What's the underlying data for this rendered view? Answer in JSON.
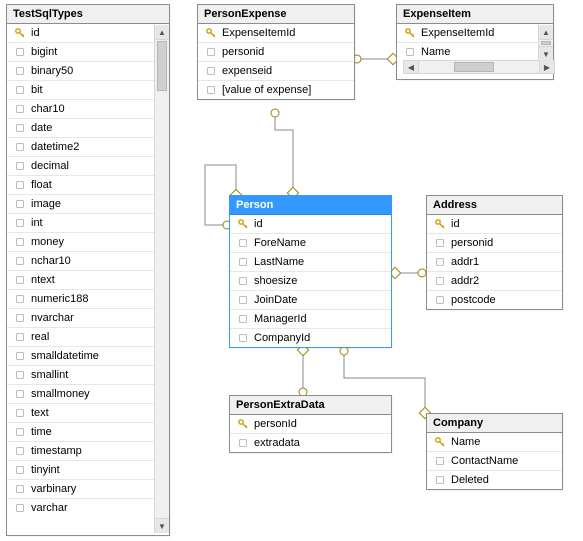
{
  "tables": {
    "testSqlTypes": {
      "title": "TestSqlTypes",
      "columns": [
        {
          "name": "id",
          "key": true
        },
        {
          "name": "bigint"
        },
        {
          "name": "binary50"
        },
        {
          "name": "bit"
        },
        {
          "name": "char10"
        },
        {
          "name": "date"
        },
        {
          "name": "datetime2"
        },
        {
          "name": "decimal"
        },
        {
          "name": "float"
        },
        {
          "name": "image"
        },
        {
          "name": "int"
        },
        {
          "name": "money"
        },
        {
          "name": "nchar10"
        },
        {
          "name": "ntext"
        },
        {
          "name": "numeric188"
        },
        {
          "name": "nvarchar"
        },
        {
          "name": "real"
        },
        {
          "name": "smalldatetime"
        },
        {
          "name": "smallint"
        },
        {
          "name": "smallmoney"
        },
        {
          "name": "text"
        },
        {
          "name": "time"
        },
        {
          "name": "timestamp"
        },
        {
          "name": "tinyint"
        },
        {
          "name": "varbinary"
        },
        {
          "name": "varchar"
        }
      ]
    },
    "personExpense": {
      "title": "PersonExpense",
      "columns": [
        {
          "name": "ExpenseItemId",
          "key": true
        },
        {
          "name": "personid"
        },
        {
          "name": "expenseid"
        },
        {
          "name": "[value of expense]"
        }
      ]
    },
    "expenseItem": {
      "title": "ExpenseItem",
      "columns": [
        {
          "name": "ExpenseItemId",
          "key": true
        },
        {
          "name": "Name"
        }
      ]
    },
    "person": {
      "title": "Person",
      "columns": [
        {
          "name": "id",
          "key": true
        },
        {
          "name": "ForeName"
        },
        {
          "name": "LastName"
        },
        {
          "name": "shoesize"
        },
        {
          "name": "JoinDate"
        },
        {
          "name": "ManagerId"
        },
        {
          "name": "CompanyId"
        }
      ]
    },
    "address": {
      "title": "Address",
      "columns": [
        {
          "name": "id",
          "key": true
        },
        {
          "name": "personid"
        },
        {
          "name": "addr1"
        },
        {
          "name": "addr2"
        },
        {
          "name": "postcode"
        }
      ]
    },
    "personExtraData": {
      "title": "PersonExtraData",
      "columns": [
        {
          "name": "personId",
          "key": true
        },
        {
          "name": "extradata"
        }
      ]
    },
    "company": {
      "title": "Company",
      "columns": [
        {
          "name": "Name",
          "key": true
        },
        {
          "name": "ContactName"
        },
        {
          "name": "Deleted"
        }
      ]
    }
  },
  "relationships": [
    {
      "from": "PersonExpense",
      "to": "ExpenseItem"
    },
    {
      "from": "PersonExpense",
      "to": "Person"
    },
    {
      "from": "Person",
      "to": "Person",
      "self": true
    },
    {
      "from": "Address",
      "to": "Person"
    },
    {
      "from": "PersonExtraData",
      "to": "Person"
    },
    {
      "from": "Person",
      "to": "Company"
    }
  ]
}
